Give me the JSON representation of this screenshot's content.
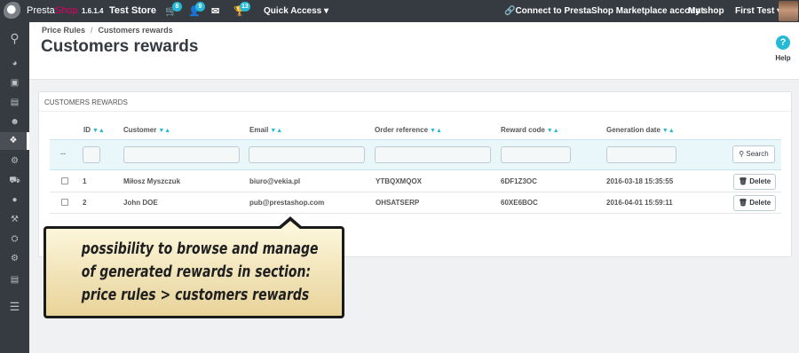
{
  "topbar": {
    "brand_a": "Presta",
    "brand_b": "Shop",
    "version": "1.6.1.4",
    "store": "Test Store",
    "orders_badge": "8",
    "customers_badge": "9",
    "messages_badge": "13",
    "quick_access": "Quick Access",
    "connect": "Connect to PrestaShop Marketplace account",
    "my_shop": "My shop",
    "user": "First Test"
  },
  "breadcrumb": {
    "parent": "Price Rules",
    "current": "Customers rewards"
  },
  "page": {
    "title": "Customers rewards",
    "help": "Help"
  },
  "panel": {
    "heading": "CUSTOMERS REWARDS"
  },
  "table": {
    "columns": [
      "ID",
      "Customer",
      "Email",
      "Order reference",
      "Reward code",
      "Generation date"
    ],
    "filter_dash": "--",
    "search_label": "Search",
    "delete_label": "Delete",
    "rows": [
      {
        "id": "1",
        "customer": "Miłosz Myszczuk",
        "email": "biuro@vekia.pl",
        "order_ref": "YTBQXMQOX",
        "reward_code": "6DF1Z3OC",
        "date": "2016-03-18 15:35:55"
      },
      {
        "id": "2",
        "customer": "John DOE",
        "email": "pub@prestashop.com",
        "order_ref": "OHSATSERP",
        "reward_code": "60XE6BOC",
        "date": "2016-04-01 15:59:11"
      }
    ]
  },
  "callout": {
    "line1": "possibility to browse and manage",
    "line2": "of generated rewards in section:",
    "line3": "price rules > customers rewards"
  }
}
